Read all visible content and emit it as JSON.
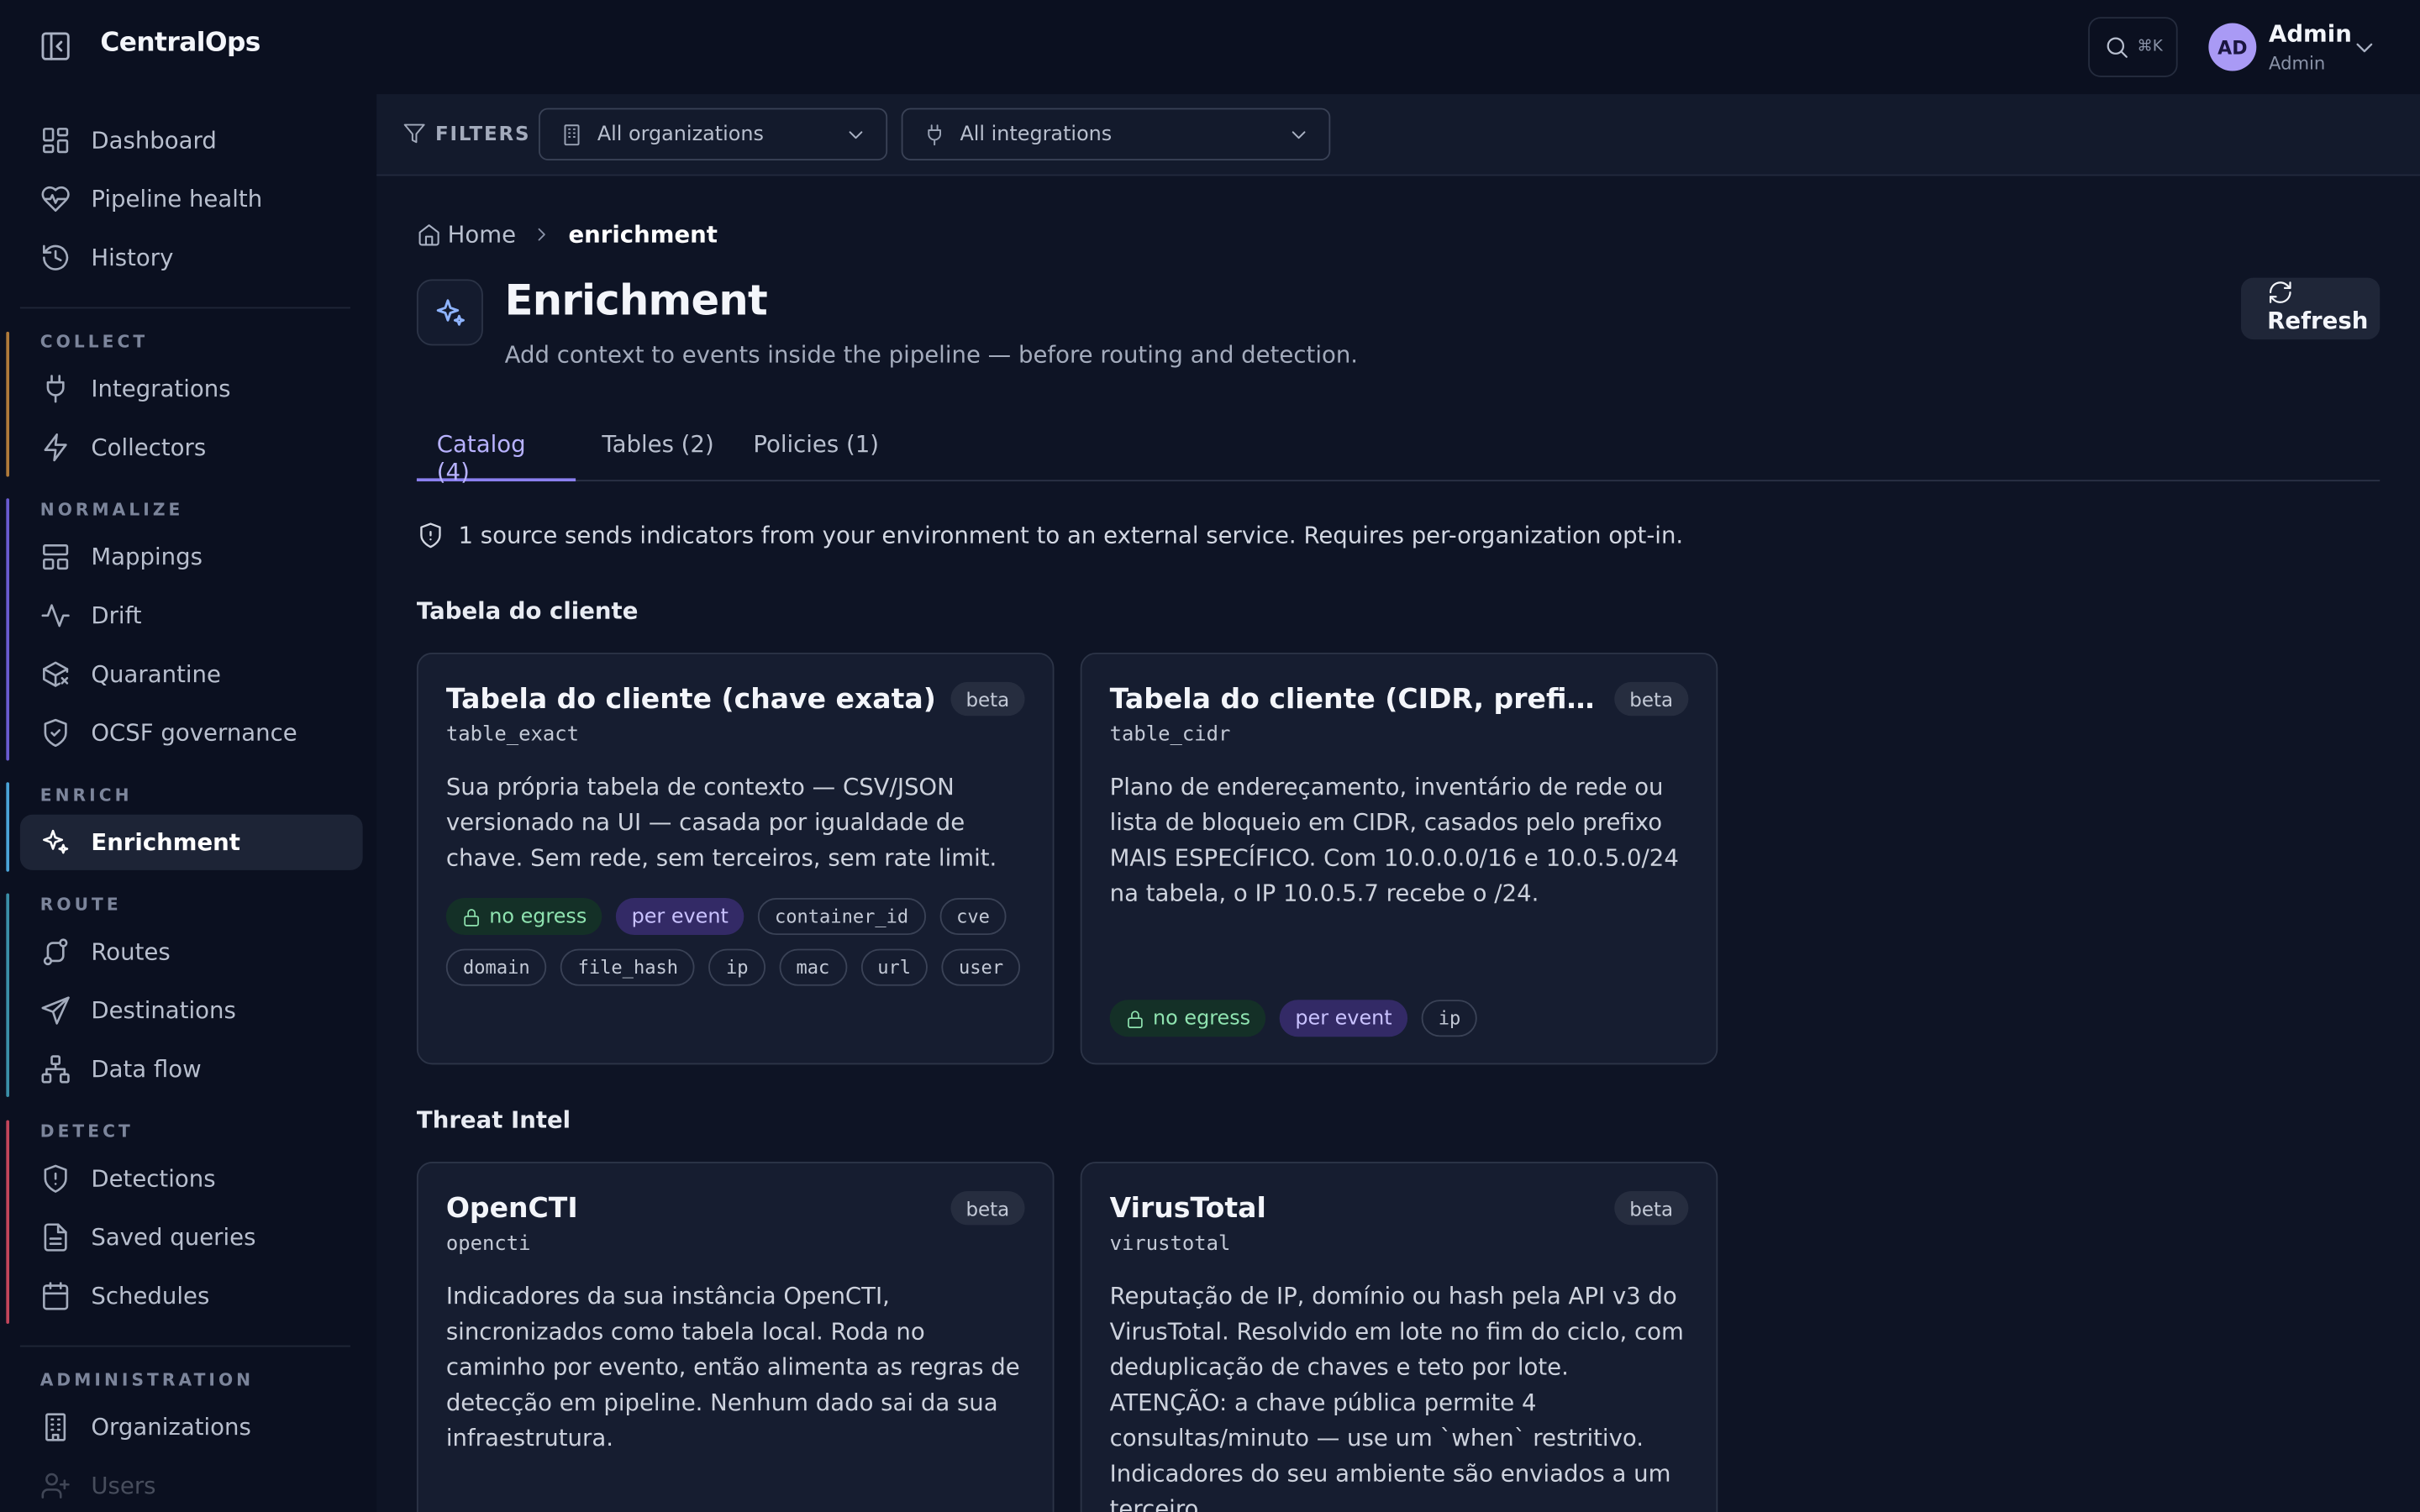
{
  "app": {
    "title": "CentralOps"
  },
  "header": {
    "search_shortcut": "⌘K",
    "user": {
      "initials": "AD",
      "name": "Admin",
      "role": "Admin"
    }
  },
  "sidebar": {
    "top_items": [
      {
        "label": "Dashboard",
        "icon": "dashboard-icon"
      },
      {
        "label": "Pipeline health",
        "icon": "heart-pulse-icon"
      },
      {
        "label": "History",
        "icon": "history-icon"
      }
    ],
    "sections": [
      {
        "label": "COLLECT",
        "color": "#b07a3a",
        "items": [
          {
            "label": "Integrations",
            "icon": "plug-icon"
          },
          {
            "label": "Collectors",
            "icon": "bolt-icon"
          }
        ]
      },
      {
        "label": "NORMALIZE",
        "color": "#6a5bd1",
        "items": [
          {
            "label": "Mappings",
            "icon": "mappings-icon"
          },
          {
            "label": "Drift",
            "icon": "activity-icon"
          },
          {
            "label": "Quarantine",
            "icon": "package-x-icon"
          },
          {
            "label": "OCSF governance",
            "icon": "shield-check-icon"
          }
        ]
      },
      {
        "label": "ENRICH",
        "color": "#4aa3d8",
        "items": [
          {
            "label": "Enrichment",
            "icon": "sparkles-icon",
            "active": true
          }
        ]
      },
      {
        "label": "ROUTE",
        "color": "#3a8fa8",
        "items": [
          {
            "label": "Routes",
            "icon": "route-icon"
          },
          {
            "label": "Destinations",
            "icon": "send-icon"
          },
          {
            "label": "Data flow",
            "icon": "network-icon"
          }
        ]
      },
      {
        "label": "DETECT",
        "color": "#c2455a",
        "items": [
          {
            "label": "Detections",
            "icon": "shield-alert-icon"
          },
          {
            "label": "Saved queries",
            "icon": "file-text-icon"
          },
          {
            "label": "Schedules",
            "icon": "calendar-icon"
          }
        ]
      },
      {
        "label": "ADMINISTRATION",
        "color": "",
        "items": [
          {
            "label": "Organizations",
            "icon": "building-icon"
          },
          {
            "label": "Users",
            "icon": "user-plus-icon"
          }
        ]
      }
    ]
  },
  "filters": {
    "label": "FILTERS",
    "organization": "All organizations",
    "integration": "All integrations"
  },
  "breadcrumb": {
    "home": "Home",
    "current": "enrichment"
  },
  "page": {
    "title": "Enrichment",
    "subtitle": "Add context to events inside the pipeline — before routing and detection.",
    "refresh_label": "Refresh"
  },
  "tabs": [
    {
      "label": "Catalog (4)",
      "active": true
    },
    {
      "label": "Tables (2)",
      "active": false
    },
    {
      "label": "Policies (1)",
      "active": false
    }
  ],
  "notice": "1 source sends indicators from your environment to an external service. Requires per-organization opt-in.",
  "groups": [
    {
      "title": "Tabela do cliente",
      "cards": [
        {
          "title": "Tabela do cliente (chave exata)",
          "key": "table_exact",
          "badge": "beta",
          "description": "Sua própria tabela de contexto — CSV/JSON versionado na UI — casada por igualdade de chave. Sem rede, sem terceiros, sem rate limit.",
          "tags": [
            "no egress",
            "per event",
            "container_id",
            "cve",
            "domain",
            "file_hash",
            "ip",
            "mac",
            "url",
            "user"
          ]
        },
        {
          "title": "Tabela do cliente (CIDR, prefixo mais ...",
          "key": "table_cidr",
          "badge": "beta",
          "description": "Plano de endereçamento, inventário de rede ou lista de bloqueio em CIDR, casados pelo prefixo MAIS ESPECÍFICO. Com 10.0.0.0/16 e 10.0.5.0/24 na tabela, o IP 10.0.5.7 recebe o /24.",
          "tags": [
            "no egress",
            "per event",
            "ip"
          ]
        }
      ]
    },
    {
      "title": "Threat Intel",
      "cards": [
        {
          "title": "OpenCTI",
          "key": "opencti",
          "badge": "beta",
          "description": "Indicadores da sua instância OpenCTI, sincronizados como tabela local. Roda no caminho por evento, então alimenta as regras de detecção em pipeline. Nenhum dado sai da sua infraestrutura."
        },
        {
          "title": "VirusTotal",
          "key": "virustotal",
          "badge": "beta",
          "description": "Reputação de IP, domínio ou hash pela API v3 do VirusTotal. Resolvido em lote no fim do ciclo, com deduplicação de chaves e teto por lote. ATENÇÃO: a chave pública permite 4 consultas/minuto — use um `when` restritivo. Indicadores do seu ambiente são enviados a um terceiro."
        }
      ]
    }
  ]
}
